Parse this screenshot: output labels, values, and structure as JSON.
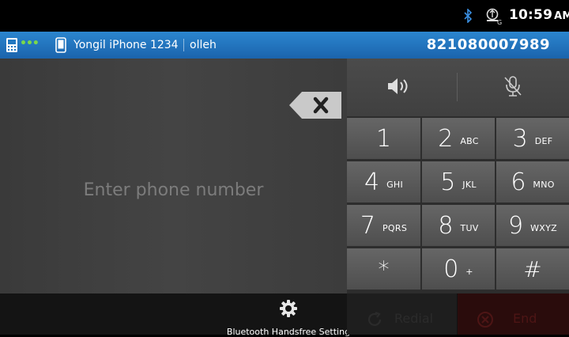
{
  "status_bar": {
    "time": "10:59",
    "ampm": "AM",
    "icons": [
      "bluetooth-icon",
      "gps-icon"
    ]
  },
  "info_bar": {
    "device_name": "Yongil iPhone 1234",
    "carrier": "olleh",
    "phone_number": "821080007989",
    "icons": [
      "device-icon",
      "phone-icon"
    ]
  },
  "dialer": {
    "placeholder": "Enter phone number",
    "clear_icon": "backspace-x-icon"
  },
  "audio_controls": {
    "speaker_icon": "speaker-icon",
    "mute_icon": "mic-mute-icon"
  },
  "keypad": [
    {
      "digit": "1",
      "letters": ""
    },
    {
      "digit": "2",
      "letters": "ABC"
    },
    {
      "digit": "3",
      "letters": "DEF"
    },
    {
      "digit": "4",
      "letters": "GHI"
    },
    {
      "digit": "5",
      "letters": "JKL"
    },
    {
      "digit": "6",
      "letters": "MNO"
    },
    {
      "digit": "7",
      "letters": "PQRS"
    },
    {
      "digit": "8",
      "letters": "TUV"
    },
    {
      "digit": "9",
      "letters": "WXYZ"
    },
    {
      "digit": "*",
      "letters": ""
    },
    {
      "digit": "0",
      "letters": "+"
    },
    {
      "digit": "#",
      "letters": ""
    }
  ],
  "bottom_bar": {
    "settings_label": "Bluetooth Handsfree Setting",
    "redial_label": "Redial",
    "end_label": "End"
  },
  "colors": {
    "accent_blue": "#2278c0",
    "key_bg": "#5a5a5a",
    "end_red": "#4d1515"
  }
}
